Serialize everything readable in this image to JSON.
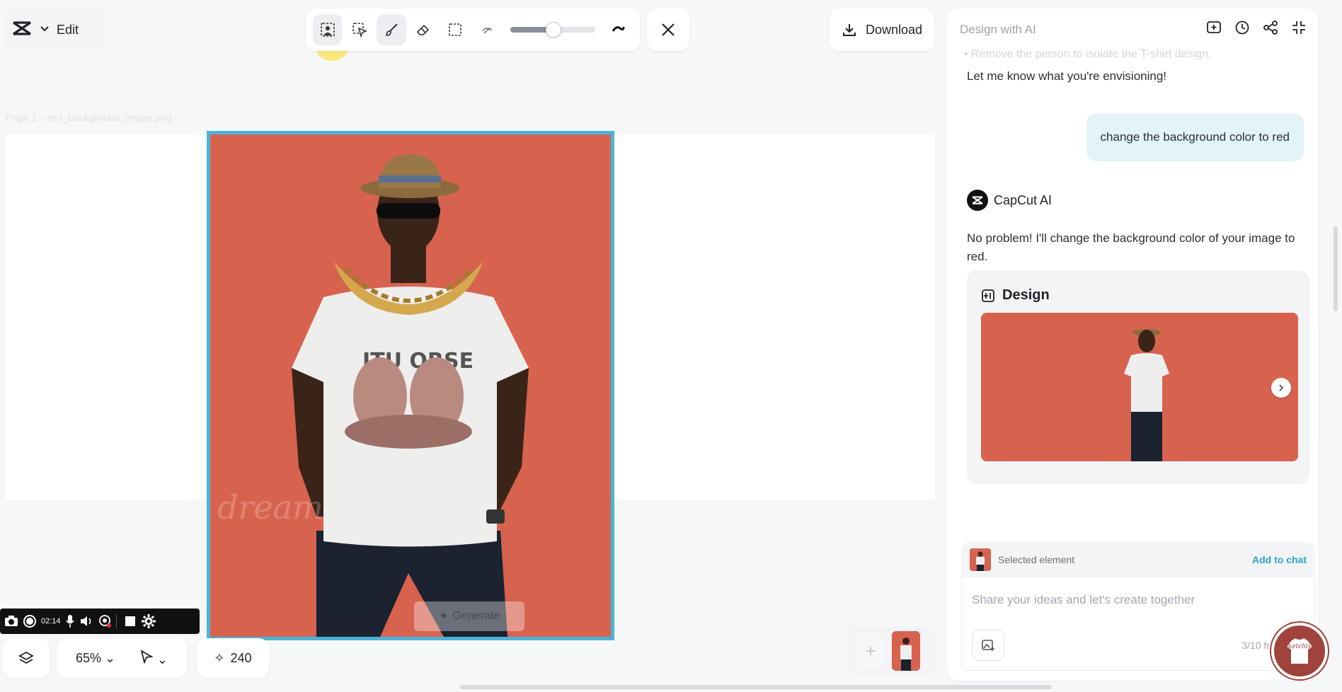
{
  "header": {
    "edit_label": "Edit",
    "download_label": "Download"
  },
  "toolbar": {
    "tools": [
      "select-person-icon",
      "smart-select-icon",
      "brush-icon",
      "eraser-icon",
      "rect-select-icon"
    ],
    "brush_size_fraction": 0.48
  },
  "canvas": {
    "page_label": "Page 1 – red_background_image.png",
    "watermark": "dream",
    "generate_label": "Generate",
    "background_color": "#d7634f",
    "frame_color": "#4ab3d8"
  },
  "recorder": {
    "time": "02:14"
  },
  "bottom": {
    "zoom": "65%",
    "credits": "240"
  },
  "panel": {
    "title": "Design with AI",
    "faded_line": "• Remove the person to isolate the T-shirt design.",
    "message_1": "Let me know what you're envisioning!",
    "user_message": "change the background color to red",
    "ai_name": "CapCut AI",
    "ai_message": "No problem! I'll change the background color of your image to red.",
    "design_title": "Design",
    "selected_label": "Selected element",
    "add_to_chat": "Add to chat",
    "input_placeholder": "Share your ideas and let's create together",
    "free_uses": "3/10 free uses"
  },
  "badge": {
    "text": "Sketchiva"
  }
}
